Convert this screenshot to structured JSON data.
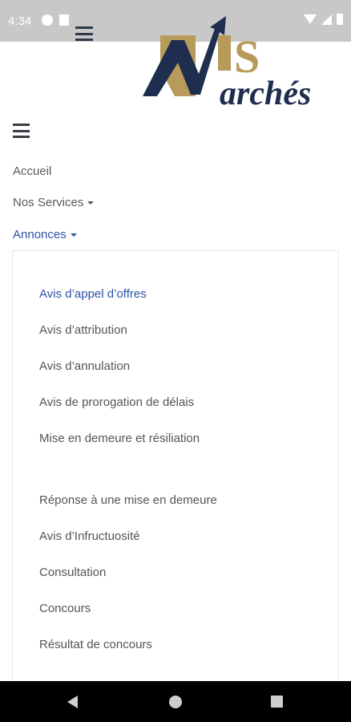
{
  "status_bar": {
    "time": "4:34",
    "icons": [
      "notification-icon",
      "sd-card-icon",
      "wifi-icon",
      "signal-icon",
      "battery-icon"
    ]
  },
  "logo": {
    "text_s": "S",
    "text_arches": "archés",
    "colors": {
      "navy": "#1f2d4f",
      "gold": "#b89a5a"
    }
  },
  "nav": {
    "accueil": "Accueil",
    "services": "Nos Services",
    "annonces": "Annonces"
  },
  "dropdown": {
    "items": [
      "Avis d’appel d’offres",
      "Avis d’attribution",
      "Avis d’annulation",
      "Avis de prorogation de délais",
      "Mise en demeure et résiliation",
      "Réponse à une mise en demeure",
      "Avis d’Infructuosité",
      "Consultation",
      "Concours",
      "Résultat de concours"
    ],
    "active_index": 0
  },
  "colors": {
    "accent": "#2b54a8",
    "text": "#555555",
    "status_bar": "#c8c8c8",
    "nav_bar": "#000000"
  }
}
